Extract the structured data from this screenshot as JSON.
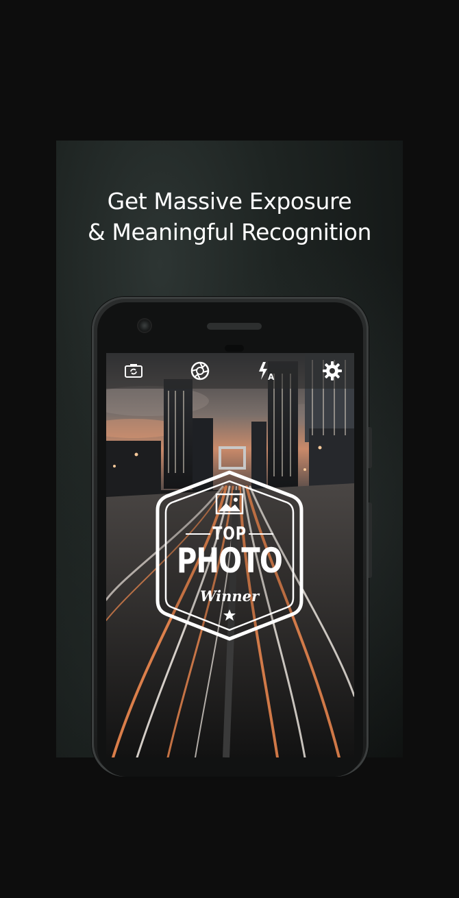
{
  "headline": {
    "line1": "Get Massive Exposure",
    "line2": "& Meaningful Recognition"
  },
  "camera_toolbar": {
    "icons": [
      "switch-camera-icon",
      "aperture-icon",
      "flash-auto-icon",
      "gear-icon"
    ],
    "flash_mode": "A"
  },
  "badge": {
    "line1": "TOP",
    "line2": "PHOTO",
    "line3": "Winner"
  },
  "colors": {
    "background": "#0d0d0d",
    "text": "#ffffff",
    "light_trail_orange": "#f08a50",
    "light_trail_white": "#f4ede6"
  }
}
